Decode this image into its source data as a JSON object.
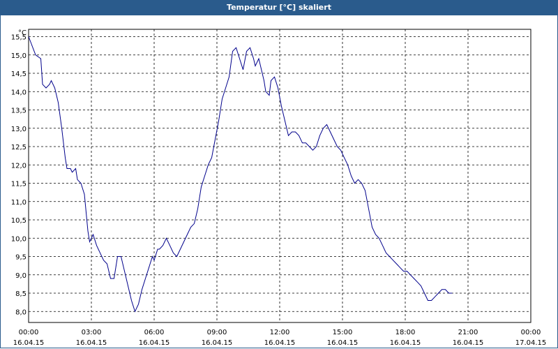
{
  "window": {
    "title": "Temperatur [°C] skaliert"
  },
  "chart_data": {
    "type": "line",
    "title": "Temperatur [°C] skaliert",
    "ylabel": "°C",
    "ylim": [
      7.7,
      15.7
    ],
    "grid": true,
    "y_ticks": [
      "8,0",
      "8,5",
      "9,0",
      "9,5",
      "10,0",
      "10,5",
      "11,0",
      "11,5",
      "12,0",
      "12,5",
      "13,0",
      "13,5",
      "14,0",
      "14,5",
      "15,0",
      "15,5"
    ],
    "y_tick_values": [
      8.0,
      8.5,
      9.0,
      9.5,
      10.0,
      10.5,
      11.0,
      11.5,
      12.0,
      12.5,
      13.0,
      13.5,
      14.0,
      14.5,
      15.0,
      15.5
    ],
    "x_ticks": [
      {
        "time": "00:00",
        "date": "16.04.15"
      },
      {
        "time": "03:00",
        "date": "16.04.15"
      },
      {
        "time": "06:00",
        "date": "16.04.15"
      },
      {
        "time": "09:00",
        "date": "16.04.15"
      },
      {
        "time": "12:00",
        "date": "16.04.15"
      },
      {
        "time": "15:00",
        "date": "16.04.15"
      },
      {
        "time": "18:00",
        "date": "16.04.15"
      },
      {
        "time": "21:00",
        "date": "16.04.15"
      },
      {
        "time": "00:00",
        "date": "17.04.15"
      }
    ],
    "series": [
      {
        "color": "#00008b",
        "points": [
          [
            "00:00",
            15.5
          ],
          [
            "00:20",
            15.0
          ],
          [
            "00:35",
            14.9
          ],
          [
            "00:40",
            14.2
          ],
          [
            "00:50",
            14.1
          ],
          [
            "01:00",
            14.2
          ],
          [
            "01:05",
            14.3
          ],
          [
            "01:15",
            14.1
          ],
          [
            "01:25",
            13.7
          ],
          [
            "01:35",
            13.0
          ],
          [
            "01:45",
            12.2
          ],
          [
            "01:50",
            11.9
          ],
          [
            "02:00",
            11.9
          ],
          [
            "02:05",
            11.8
          ],
          [
            "02:15",
            11.9
          ],
          [
            "02:20",
            11.6
          ],
          [
            "02:30",
            11.5
          ],
          [
            "02:40",
            11.2
          ],
          [
            "02:50",
            10.2
          ],
          [
            "02:55",
            9.9
          ],
          [
            "03:05",
            10.1
          ],
          [
            "03:15",
            9.8
          ],
          [
            "03:25",
            9.6
          ],
          [
            "03:35",
            9.4
          ],
          [
            "03:45",
            9.3
          ],
          [
            "03:55",
            8.9
          ],
          [
            "04:05",
            8.9
          ],
          [
            "04:15",
            9.5
          ],
          [
            "04:25",
            9.5
          ],
          [
            "04:40",
            8.9
          ],
          [
            "04:55",
            8.3
          ],
          [
            "05:05",
            8.0
          ],
          [
            "05:15",
            8.2
          ],
          [
            "05:25",
            8.6
          ],
          [
            "05:35",
            8.9
          ],
          [
            "05:45",
            9.2
          ],
          [
            "05:55",
            9.5
          ],
          [
            "06:00",
            9.4
          ],
          [
            "06:10",
            9.7
          ],
          [
            "06:15",
            9.7
          ],
          [
            "06:25",
            9.8
          ],
          [
            "06:35",
            10.0
          ],
          [
            "06:45",
            9.8
          ],
          [
            "06:55",
            9.6
          ],
          [
            "07:05",
            9.5
          ],
          [
            "07:15",
            9.7
          ],
          [
            "07:25",
            9.9
          ],
          [
            "07:35",
            10.1
          ],
          [
            "07:45",
            10.3
          ],
          [
            "07:55",
            10.4
          ],
          [
            "08:05",
            10.8
          ],
          [
            "08:15",
            11.4
          ],
          [
            "08:25",
            11.7
          ],
          [
            "08:35",
            12.0
          ],
          [
            "08:45",
            12.2
          ],
          [
            "08:55",
            12.7
          ],
          [
            "09:05",
            13.2
          ],
          [
            "09:15",
            13.8
          ],
          [
            "09:25",
            14.1
          ],
          [
            "09:35",
            14.4
          ],
          [
            "09:45",
            15.1
          ],
          [
            "09:55",
            15.2
          ],
          [
            "10:05",
            14.9
          ],
          [
            "10:15",
            14.6
          ],
          [
            "10:25",
            15.1
          ],
          [
            "10:35",
            15.2
          ],
          [
            "10:45",
            14.9
          ],
          [
            "10:50",
            14.7
          ],
          [
            "11:00",
            14.9
          ],
          [
            "11:05",
            14.7
          ],
          [
            "11:15",
            14.3
          ],
          [
            "11:20",
            14.0
          ],
          [
            "11:30",
            13.9
          ],
          [
            "11:35",
            14.3
          ],
          [
            "11:45",
            14.4
          ],
          [
            "11:55",
            14.1
          ],
          [
            "12:05",
            13.6
          ],
          [
            "12:15",
            13.2
          ],
          [
            "12:25",
            12.8
          ],
          [
            "12:35",
            12.9
          ],
          [
            "12:45",
            12.9
          ],
          [
            "12:55",
            12.8
          ],
          [
            "13:05",
            12.6
          ],
          [
            "13:15",
            12.6
          ],
          [
            "13:25",
            12.5
          ],
          [
            "13:35",
            12.4
          ],
          [
            "13:45",
            12.5
          ],
          [
            "13:55",
            12.8
          ],
          [
            "14:05",
            13.0
          ],
          [
            "14:15",
            13.1
          ],
          [
            "14:25",
            12.9
          ],
          [
            "14:35",
            12.7
          ],
          [
            "14:45",
            12.5
          ],
          [
            "14:55",
            12.4
          ],
          [
            "15:05",
            12.2
          ],
          [
            "15:15",
            12.0
          ],
          [
            "15:25",
            11.7
          ],
          [
            "15:35",
            11.5
          ],
          [
            "15:45",
            11.6
          ],
          [
            "15:55",
            11.5
          ],
          [
            "16:05",
            11.3
          ],
          [
            "16:15",
            10.8
          ],
          [
            "16:25",
            10.3
          ],
          [
            "16:35",
            10.1
          ],
          [
            "16:45",
            10.0
          ],
          [
            "16:55",
            9.8
          ],
          [
            "17:05",
            9.6
          ],
          [
            "17:15",
            9.5
          ],
          [
            "17:25",
            9.4
          ],
          [
            "17:35",
            9.3
          ],
          [
            "17:45",
            9.2
          ],
          [
            "17:55",
            9.1
          ],
          [
            "18:05",
            9.1
          ],
          [
            "18:15",
            9.0
          ],
          [
            "18:25",
            8.9
          ],
          [
            "18:35",
            8.8
          ],
          [
            "18:45",
            8.7
          ],
          [
            "18:55",
            8.5
          ],
          [
            "19:05",
            8.3
          ],
          [
            "19:15",
            8.3
          ],
          [
            "19:25",
            8.4
          ],
          [
            "19:35",
            8.5
          ],
          [
            "19:45",
            8.6
          ],
          [
            "19:55",
            8.6
          ],
          [
            "20:05",
            8.5
          ],
          [
            "20:15",
            8.5
          ]
        ]
      }
    ]
  }
}
